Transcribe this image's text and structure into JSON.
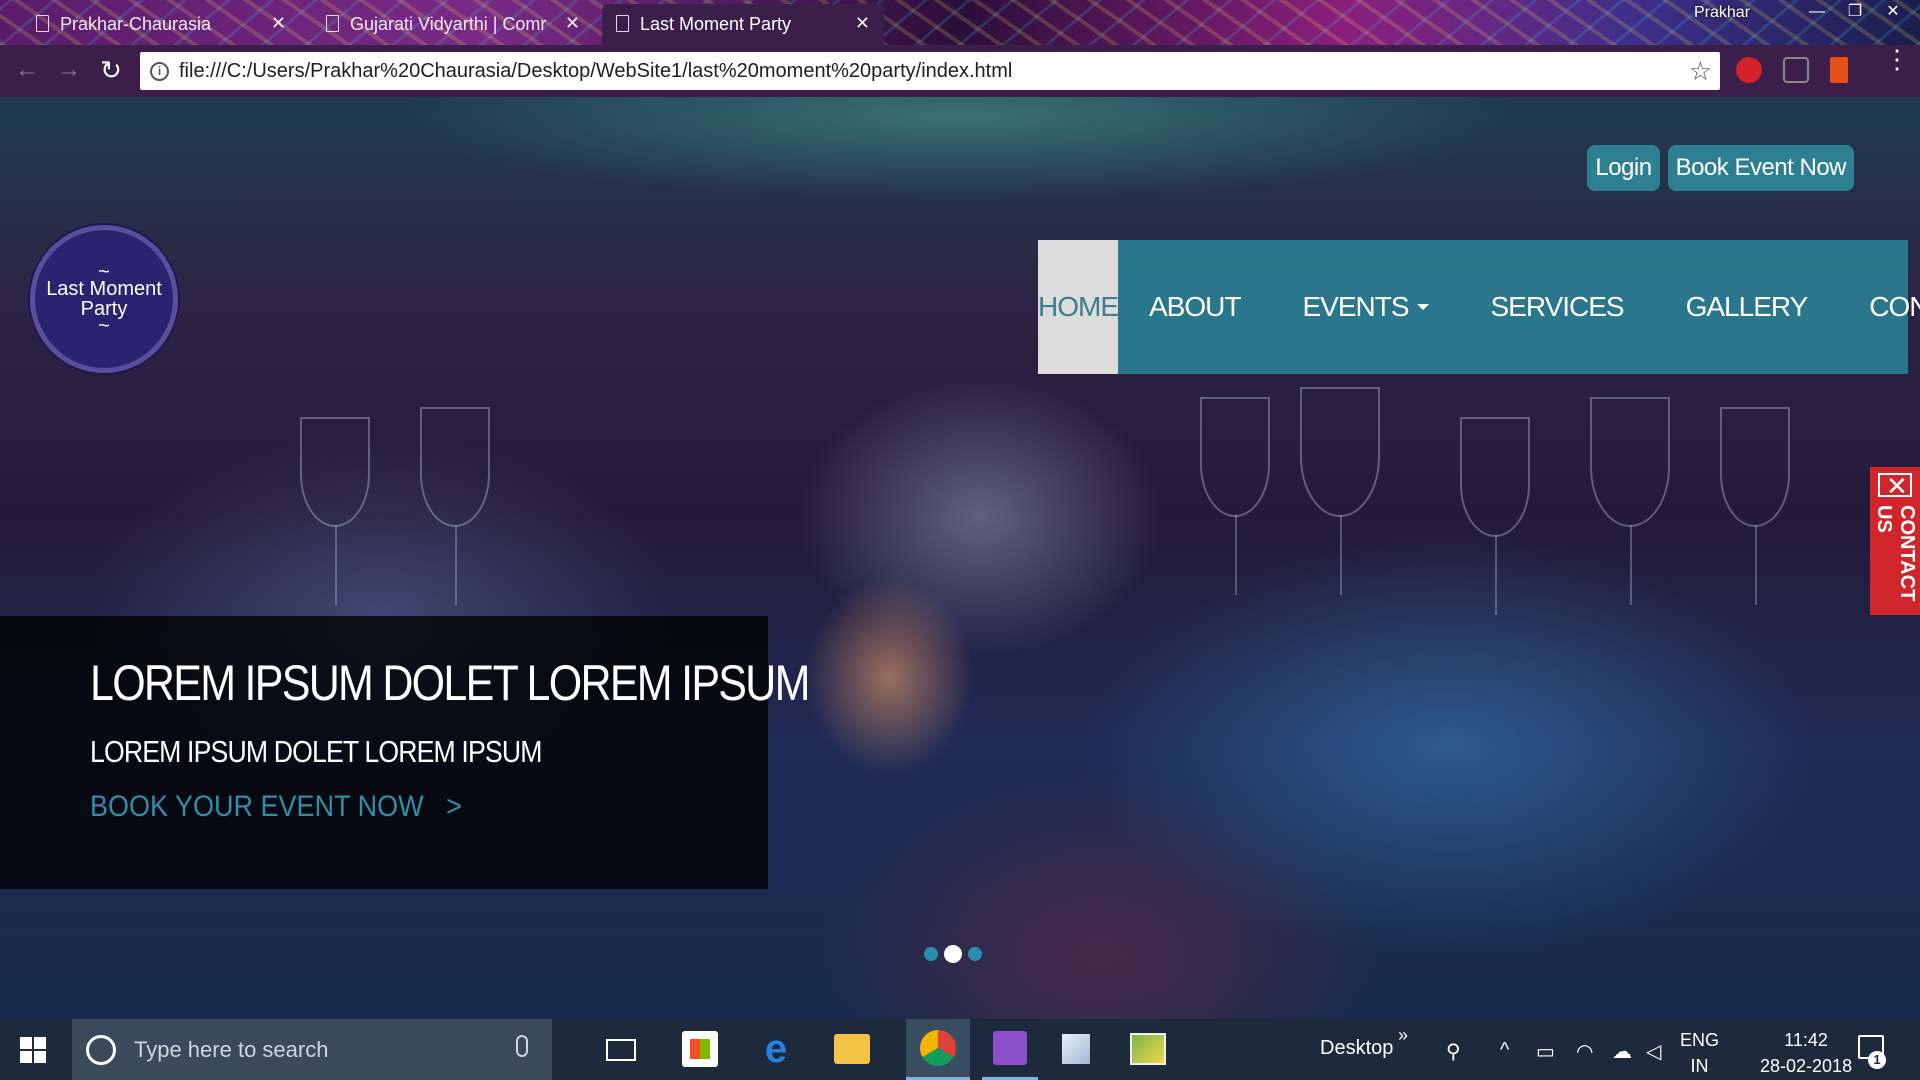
{
  "browser": {
    "tabs": [
      {
        "label": "Prakhar-Chaurasia",
        "active": false
      },
      {
        "label": "Gujarati Vidyarthi | Comr",
        "active": false
      },
      {
        "label": "Last Moment Party",
        "active": true
      }
    ],
    "profile_name": "Prakhar",
    "url": "file:///C:/Users/Prakhar%20Chaurasia/Desktop/WebSite1/last%20moment%20party/index.html",
    "icons": [
      "back-icon",
      "forward-icon",
      "reload-icon",
      "info-icon",
      "star-icon",
      "extension-icon",
      "cast-icon",
      "office-icon",
      "menu-icon"
    ]
  },
  "site": {
    "logo_text": "Last Moment Party",
    "top_actions": {
      "login": "Login",
      "book": "Book Event Now"
    },
    "nav": [
      {
        "label": "HOME",
        "active": true
      },
      {
        "label": "ABOUT"
      },
      {
        "label": "EVENTS",
        "dropdown": true
      },
      {
        "label": "SERVICES"
      },
      {
        "label": "GALLERY"
      },
      {
        "label": "CONTACT"
      }
    ],
    "contact_tab": "CONTACT US",
    "caption": {
      "title": "LOREM IPSUM DOLET LOREM IPSUM",
      "subtitle": "LOREM IPSUM DOLET LOREM IPSUM",
      "cta": "BOOK YOUR EVENT NOW",
      "cta_arrow": ">"
    },
    "carousel": {
      "slides": 3,
      "active_index": 1
    },
    "colors": {
      "accent": "#2f7f92",
      "nav_bg": "#2a8296",
      "contact_tab": "#d0262b"
    }
  },
  "taskbar": {
    "search_placeholder": "Type here to search",
    "desktop_label": "Desktop",
    "chevron": "»",
    "language": {
      "line1": "ENG",
      "line2": "IN"
    },
    "clock": {
      "time": "11:42",
      "date": "28-02-2018"
    },
    "notification_count": "1"
  }
}
